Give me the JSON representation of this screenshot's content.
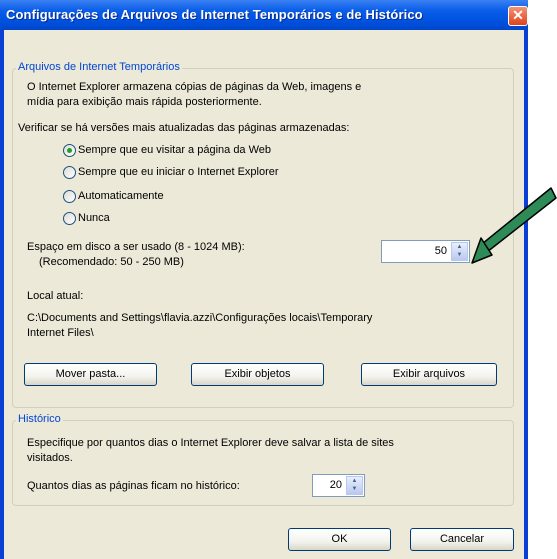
{
  "window": {
    "title": "Configurações de Arquivos de Internet Temporários e de Histórico",
    "close_glyph": "✕"
  },
  "temp_files": {
    "legend": "Arquivos de Internet Temporários",
    "description_line1": "O Internet Explorer armazena cópias de páginas da Web, imagens e",
    "description_line2": "mídia para exibição mais rápida posteriormente.",
    "check_label": "Verificar se há versões mais atualizadas das páginas armazenadas:",
    "options": [
      {
        "label": "Sempre que eu visitar a página da Web",
        "selected": true
      },
      {
        "label": "Sempre que eu iniciar o Internet Explorer",
        "selected": false
      },
      {
        "label": "Automaticamente",
        "selected": false
      },
      {
        "label": "Nunca",
        "selected": false
      }
    ],
    "disk_label": "Espaço em disco a ser usado (8 - 1024 MB):",
    "disk_recommended": "(Recomendado: 50 - 250 MB)",
    "disk_value": "50",
    "location_label": "Local atual:",
    "location_line1": "C:\\Documents and Settings\\flavia.azzi\\Configurações locais\\Temporary",
    "location_line2": "Internet Files\\",
    "buttons": {
      "move": "Mover pasta...",
      "objects": "Exibir objetos",
      "files": "Exibir arquivos"
    }
  },
  "history": {
    "legend": "Histórico",
    "description_line1": "Especifique por quantos dias o Internet Explorer deve salvar a lista de sites",
    "description_line2": "visitados.",
    "days_label": "Quantos dias as páginas ficam no histórico:",
    "days_value": "20"
  },
  "footer": {
    "ok": "OK",
    "cancel": "Cancelar"
  },
  "colors": {
    "title_bar": "#0055e5",
    "dialog_bg": "#ece9d8",
    "group_title": "#0046d5",
    "annotation_arrow": "#2e8b57"
  },
  "icons": {
    "spin_up": "up-arrow-icon",
    "spin_down": "down-arrow-icon",
    "radio_selected": "radio-selected-icon",
    "annotation": "green-arrow-icon"
  }
}
